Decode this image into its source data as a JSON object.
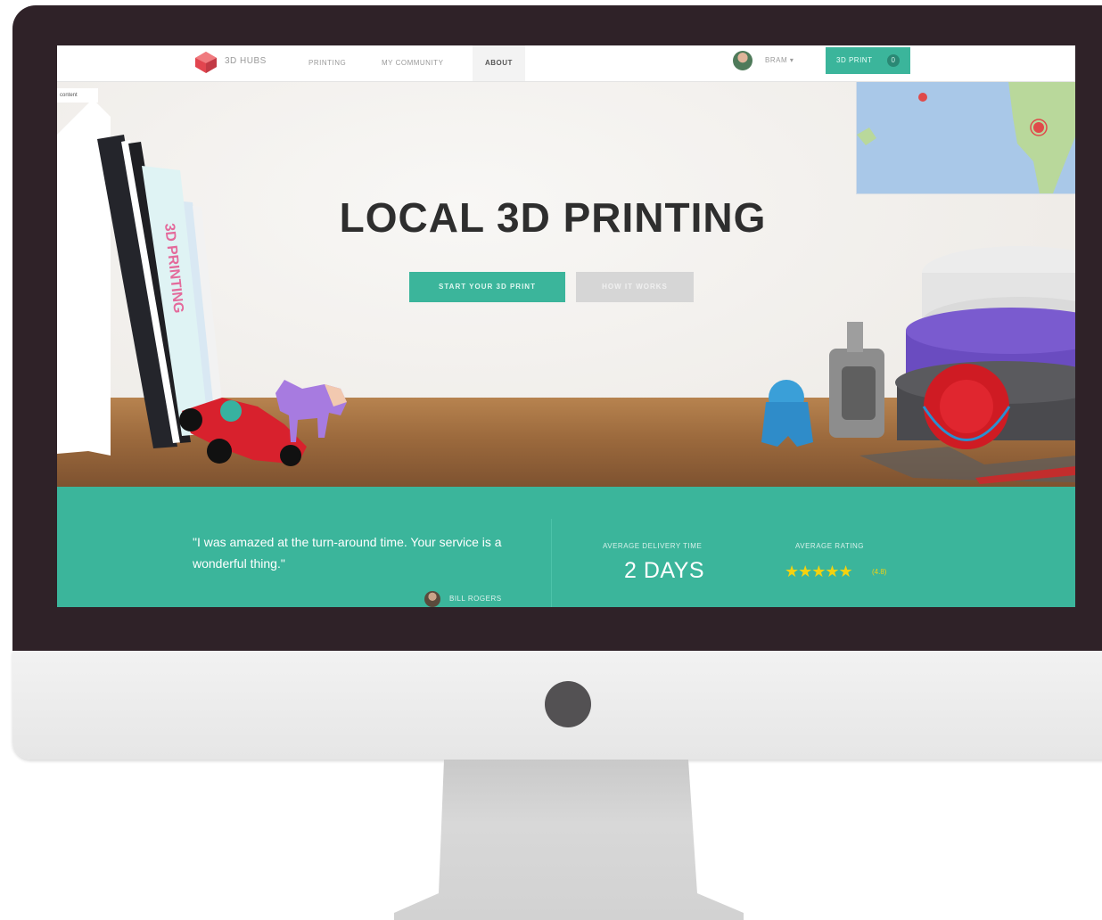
{
  "colors": {
    "bezel": "#2f2228",
    "accent": "#3bb59b",
    "title": "#2e2e2e",
    "star": "#f4d20f",
    "secondary_button": "#d6d6d6"
  },
  "navbar": {
    "logo_icon": "3d-hubs-logo-icon",
    "logo_text": "3D HUBS",
    "items": [
      {
        "label": "PRINTING"
      },
      {
        "label": "MY COMMUNITY"
      },
      {
        "label": "ABOUT",
        "active": true
      }
    ],
    "user_name": "BRAM ▾",
    "print_button_label": "3D PRINT",
    "print_button_badge": "0"
  },
  "hero": {
    "side_tab": "content",
    "title": "LOCAL 3D PRINTING",
    "book_spine": "3D PRINTING",
    "primary_button": "START YOUR 3D PRINT",
    "secondary_button": "HOW IT WORKS"
  },
  "testimonial": {
    "quote": "\"I was amazed at the turn-around time. Your service is a wonderful thing.\"",
    "author": "BILL ROGERS"
  },
  "stats": {
    "delivery_label": "AVERAGE DELIVERY TIME",
    "delivery_value": "2 DAYS",
    "rating_label": "AVERAGE RATING",
    "rating_stars": "★★★★★",
    "rating_value": "(4.8)"
  }
}
